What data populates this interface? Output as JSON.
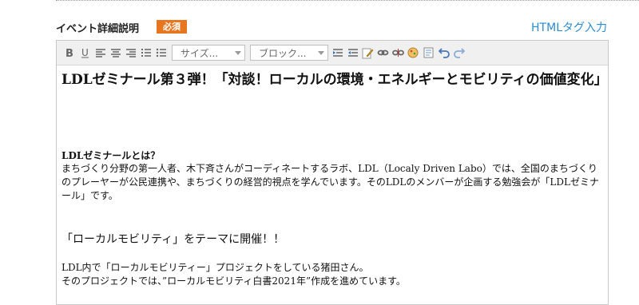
{
  "header": {
    "field_label": "イベント詳細説明",
    "required_badge": "必須",
    "html_link": "HTMLタグ入力"
  },
  "toolbar": {
    "size_select": "サイズ...",
    "block_select": "ブロック..."
  },
  "content": {
    "title": "LDLゼミナール第３弾！「対談！ローカルの環境・エネルギーとモビリティの価値変化」",
    "section1_heading": "LDLゼミナールとは？",
    "section1_body": "まちづくり分野の第一人者、木下斉さんがコーディネートするラボ、LDL（Localy Driven Labo）では、全国のまちづくりのプレーヤーが公民連携や、まちづくりの経営的視点を学んでいます。そのLDLのメンバーが企画する勉強会が「LDLゼミナール」です。",
    "section2_heading": "「ローカルモビリティ」をテーマに開催！！",
    "section2_line1": " LDL内で「ローカルモビリティー」プロジェクトをしている猪田さん。",
    "section2_line2": "そのプロジェクトでは、”ローカルモビリティ白書2021年”作成を進めています。"
  },
  "colors": {
    "accent": "#e8761e",
    "link": "#2a8bd0",
    "toolbar_bg": "#f0f0f0"
  }
}
